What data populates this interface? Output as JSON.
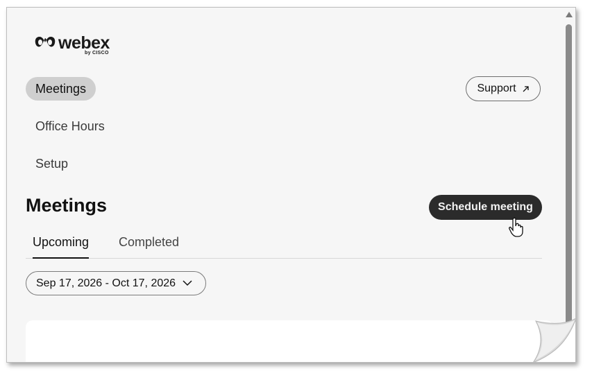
{
  "brand": {
    "name": "webex",
    "byline": "by CISCO"
  },
  "nav": {
    "items": [
      {
        "label": "Meetings",
        "active": true
      },
      {
        "label": "Office Hours",
        "active": false
      },
      {
        "label": "Setup",
        "active": false
      }
    ]
  },
  "header": {
    "support_label": "Support",
    "support_icon": "external-link-arrow-icon"
  },
  "main": {
    "title": "Meetings",
    "schedule_label": "Schedule meeting",
    "tabs": [
      {
        "label": "Upcoming",
        "active": true
      },
      {
        "label": "Completed",
        "active": false
      }
    ],
    "date_range": "Sep 17, 2026 - Oct 17, 2026",
    "date_icon": "chevron-down-icon"
  },
  "colors": {
    "background": "#f6f6f6",
    "active_nav": "#cfcfcf",
    "primary_button": "#2b2b2b",
    "card": "#ffffff"
  }
}
